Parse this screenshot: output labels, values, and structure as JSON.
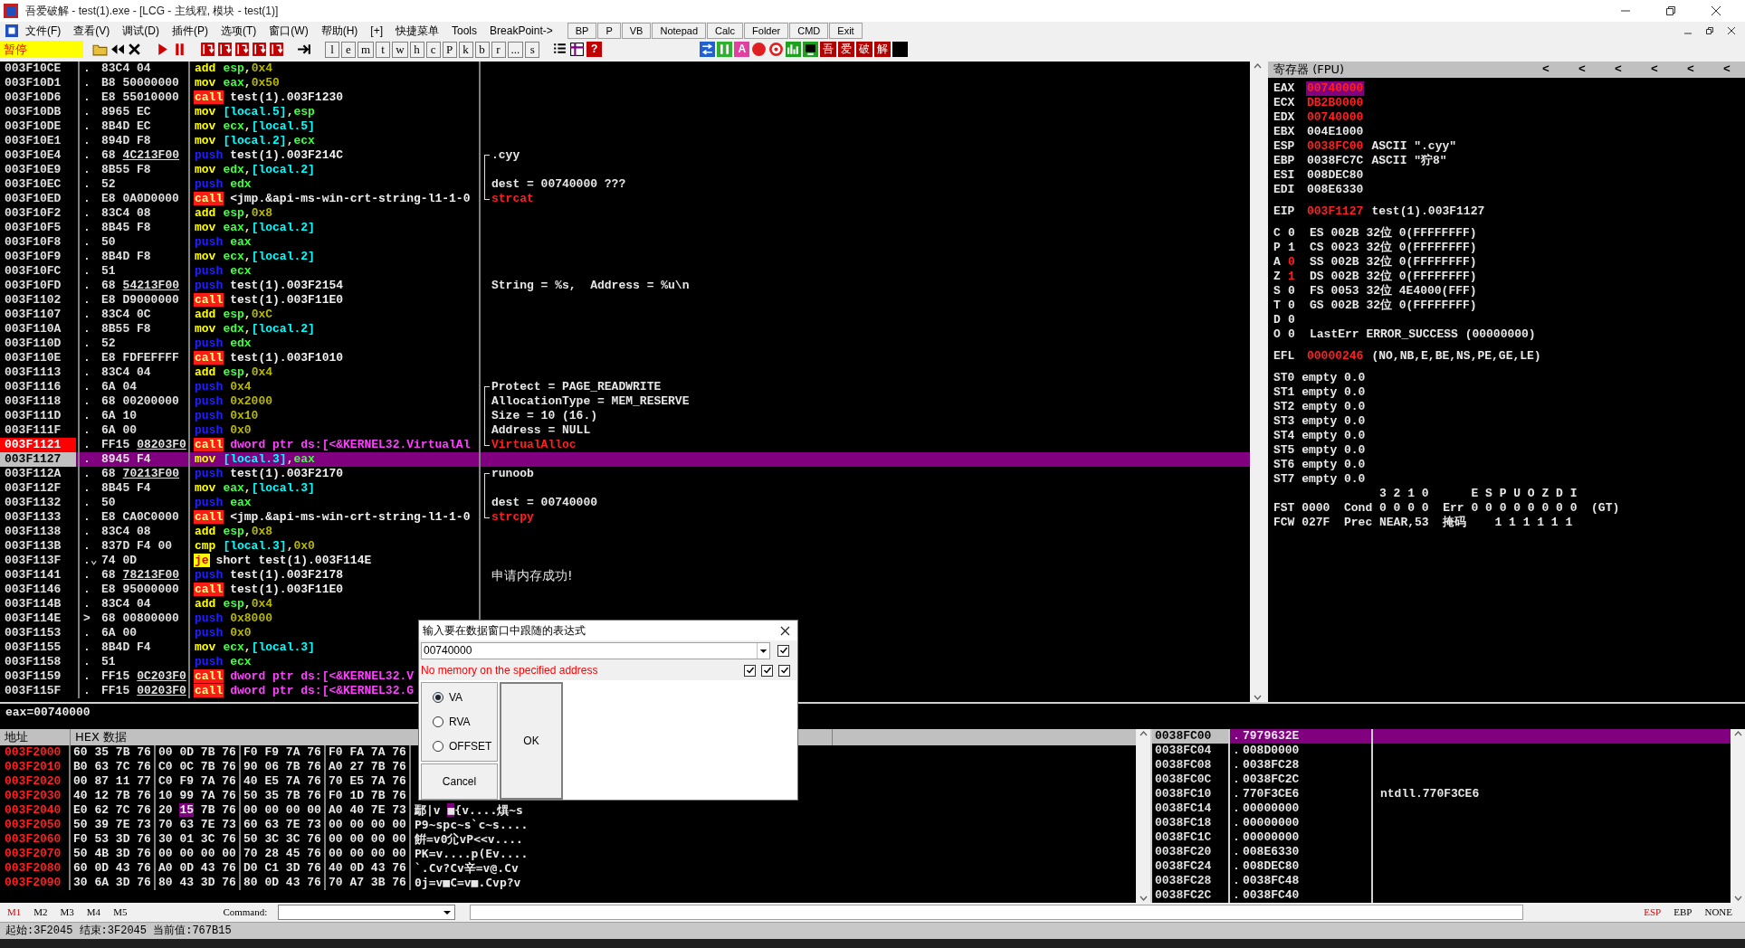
{
  "window": {
    "title": "吾爱破解 - test(1).exe - [LCG - 主线程, 模块 - test(1)]"
  },
  "menu": [
    "文件(F)",
    "查看(V)",
    "调试(D)",
    "插件(P)",
    "选项(T)",
    "窗口(W)",
    "帮助(H)",
    "[+]",
    "快捷菜单",
    "Tools",
    "BreakPoint->"
  ],
  "quick_buttons": [
    "BP",
    "P",
    "VB",
    "Notepad",
    "Calc",
    "Folder",
    "CMD",
    "Exit"
  ],
  "toolbar": {
    "status": "暂停",
    "items": [
      {
        "kind": "open"
      },
      {
        "kind": "rewind"
      },
      {
        "kind": "close"
      },
      {
        "kind": "gap"
      },
      {
        "kind": "run"
      },
      {
        "kind": "pause"
      },
      {
        "kind": "gap"
      },
      {
        "kind": "step"
      },
      {
        "kind": "step"
      },
      {
        "kind": "step"
      },
      {
        "kind": "step"
      },
      {
        "kind": "step"
      },
      {
        "kind": "gap"
      },
      {
        "kind": "goto"
      },
      {
        "kind": "gap"
      },
      {
        "kind": "letter",
        "label": "l"
      },
      {
        "kind": "letter",
        "label": "e"
      },
      {
        "kind": "letter",
        "label": "m"
      },
      {
        "kind": "letter",
        "label": "t"
      },
      {
        "kind": "letter",
        "label": "w"
      },
      {
        "kind": "letter",
        "label": "h"
      },
      {
        "kind": "letter",
        "label": "c"
      },
      {
        "kind": "letter",
        "label": "P"
      },
      {
        "kind": "letter",
        "label": "k"
      },
      {
        "kind": "letter",
        "label": "b"
      },
      {
        "kind": "letter",
        "label": "r"
      },
      {
        "kind": "letter",
        "label": "..."
      },
      {
        "kind": "letter",
        "label": "s"
      },
      {
        "kind": "gap"
      },
      {
        "kind": "list"
      },
      {
        "kind": "windows"
      },
      {
        "kind": "help",
        "label": "?"
      }
    ],
    "right_items": [
      {
        "kind": "swap"
      },
      {
        "kind": "bars"
      },
      {
        "kind": "pink_tile",
        "label": "A"
      },
      {
        "kind": "record"
      },
      {
        "kind": "target"
      },
      {
        "kind": "chart"
      },
      {
        "kind": "monitor"
      },
      {
        "kind": "red_tile",
        "label": "吾"
      },
      {
        "kind": "red_tile",
        "label": "爱"
      },
      {
        "kind": "red_tile",
        "label": "破"
      },
      {
        "kind": "red_tile",
        "label": "解"
      },
      {
        "kind": "black"
      }
    ]
  },
  "disassembly": {
    "rows": [
      {
        "address": "003F10CE",
        "marker": ".",
        "bytes": "83C4 04",
        "op": {
          "text": "add",
          "kind": "arith"
        },
        "args": [
          {
            "text": "esp",
            "kind": "reg"
          },
          {
            "text": ",",
            "kind": "sep"
          },
          {
            "text": "0x4",
            "kind": "imm"
          }
        ],
        "breakpoint": false,
        "selected": false
      },
      {
        "address": "003F10D1",
        "marker": ".",
        "bytes": "B8 50000000",
        "op": {
          "text": "mov",
          "kind": "arith"
        },
        "args": [
          {
            "text": "eax",
            "kind": "reg"
          },
          {
            "text": ",",
            "kind": "sep"
          },
          {
            "text": "0x50",
            "kind": "imm"
          }
        ],
        "breakpoint": false,
        "selected": false
      },
      {
        "address": "003F10D6",
        "marker": ".",
        "bytes": "E8 55010000",
        "op": {
          "text": "call",
          "kind": "call"
        },
        "args": [
          {
            "text": "test(1).003F1230",
            "kind": "sym"
          }
        ],
        "breakpoint": false,
        "selected": false
      },
      {
        "address": "003F10DB",
        "marker": ".",
        "bytes": "8965 EC",
        "op": {
          "text": "mov",
          "kind": "arith"
        },
        "args": [
          {
            "text": "[local.5]",
            "kind": "mem"
          },
          {
            "text": ",",
            "kind": "sep"
          },
          {
            "text": "esp",
            "kind": "reg"
          }
        ],
        "breakpoint": false,
        "selected": false
      },
      {
        "address": "003F10DE",
        "marker": ".",
        "bytes": "8B4D EC",
        "op": {
          "text": "mov",
          "kind": "arith"
        },
        "args": [
          {
            "text": "ecx",
            "kind": "reg"
          },
          {
            "text": ",",
            "kind": "sep"
          },
          {
            "text": "[local.5]",
            "kind": "mem"
          }
        ],
        "breakpoint": false,
        "selected": false
      },
      {
        "address": "003F10E1",
        "marker": ".",
        "bytes": "894D F8",
        "op": {
          "text": "mov",
          "kind": "arith"
        },
        "args": [
          {
            "text": "[local.2]",
            "kind": "mem"
          },
          {
            "text": ",",
            "kind": "sep"
          },
          {
            "text": "ecx",
            "kind": "reg"
          }
        ],
        "breakpoint": false,
        "selected": false
      },
      {
        "address": "003F10E4",
        "marker": ".",
        "bytes": "68",
        "reloc": "4C213F00",
        "op": {
          "text": "push",
          "kind": "stack"
        },
        "args": [
          {
            "text": "test(1).003F214C",
            "kind": "sym"
          }
        ],
        "comment": {
          "text": ".cyy",
          "kind": "text"
        },
        "bracket": {
          "kind": "start"
        },
        "breakpoint": false,
        "selected": false
      },
      {
        "address": "003F10E9",
        "marker": ".",
        "bytes": "8B55 F8",
        "op": {
          "text": "mov",
          "kind": "arith"
        },
        "args": [
          {
            "text": "edx",
            "kind": "reg"
          },
          {
            "text": ",",
            "kind": "sep"
          },
          {
            "text": "[local.2]",
            "kind": "mem"
          }
        ],
        "bracket": {
          "kind": "mid"
        },
        "breakpoint": false,
        "selected": false
      },
      {
        "address": "003F10EC",
        "marker": ".",
        "bytes": "52",
        "op": {
          "text": "push",
          "kind": "stack"
        },
        "args": [
          {
            "text": "edx",
            "kind": "reg"
          }
        ],
        "comment": {
          "text": "dest = 00740000 ???",
          "kind": "text"
        },
        "bracket": {
          "kind": "mid"
        },
        "breakpoint": false,
        "selected": false
      },
      {
        "address": "003F10ED",
        "marker": ".",
        "bytes": "E8 0A0D0000",
        "op": {
          "text": "call",
          "kind": "call"
        },
        "args": [
          {
            "text": "<jmp.&api-ms-win-crt-string-l1-1-0",
            "kind": "sym"
          }
        ],
        "comment": {
          "text": "strcat",
          "kind": "api"
        },
        "bracket": {
          "kind": "end"
        },
        "breakpoint": false,
        "selected": false
      },
      {
        "address": "003F10F2",
        "marker": ".",
        "bytes": "83C4 08",
        "op": {
          "text": "add",
          "kind": "arith"
        },
        "args": [
          {
            "text": "esp",
            "kind": "reg"
          },
          {
            "text": ",",
            "kind": "sep"
          },
          {
            "text": "0x8",
            "kind": "imm"
          }
        ],
        "breakpoint": false,
        "selected": false
      },
      {
        "address": "003F10F5",
        "marker": ".",
        "bytes": "8B45 F8",
        "op": {
          "text": "mov",
          "kind": "arith"
        },
        "args": [
          {
            "text": "eax",
            "kind": "reg"
          },
          {
            "text": ",",
            "kind": "sep"
          },
          {
            "text": "[local.2]",
            "kind": "mem"
          }
        ],
        "breakpoint": false,
        "selected": false
      },
      {
        "address": "003F10F8",
        "marker": ".",
        "bytes": "50",
        "op": {
          "text": "push",
          "kind": "stack"
        },
        "args": [
          {
            "text": "eax",
            "kind": "reg"
          }
        ],
        "breakpoint": false,
        "selected": false
      },
      {
        "address": "003F10F9",
        "marker": ".",
        "bytes": "8B4D F8",
        "op": {
          "text": "mov",
          "kind": "arith"
        },
        "args": [
          {
            "text": "ecx",
            "kind": "reg"
          },
          {
            "text": ",",
            "kind": "sep"
          },
          {
            "text": "[local.2]",
            "kind": "mem"
          }
        ],
        "breakpoint": false,
        "selected": false
      },
      {
        "address": "003F10FC",
        "marker": ".",
        "bytes": "51",
        "op": {
          "text": "push",
          "kind": "stack"
        },
        "args": [
          {
            "text": "ecx",
            "kind": "reg"
          }
        ],
        "breakpoint": false,
        "selected": false
      },
      {
        "address": "003F10FD",
        "marker": ".",
        "bytes": "68",
        "reloc": "54213F00",
        "op": {
          "text": "push",
          "kind": "stack"
        },
        "args": [
          {
            "text": "test(1).003F2154",
            "kind": "sym"
          }
        ],
        "comment": {
          "text": "String = %s,  Address = %u\\n",
          "kind": "text"
        },
        "breakpoint": false,
        "selected": false
      },
      {
        "address": "003F1102",
        "marker": ".",
        "bytes": "E8 D9000000",
        "op": {
          "text": "call",
          "kind": "call"
        },
        "args": [
          {
            "text": "test(1).003F11E0",
            "kind": "sym"
          }
        ],
        "breakpoint": false,
        "selected": false
      },
      {
        "address": "003F1107",
        "marker": ".",
        "bytes": "83C4 0C",
        "op": {
          "text": "add",
          "kind": "arith"
        },
        "args": [
          {
            "text": "esp",
            "kind": "reg"
          },
          {
            "text": ",",
            "kind": "sep"
          },
          {
            "text": "0xC",
            "kind": "imm"
          }
        ],
        "breakpoint": false,
        "selected": false
      },
      {
        "address": "003F110A",
        "marker": ".",
        "bytes": "8B55 F8",
        "op": {
          "text": "mov",
          "kind": "arith"
        },
        "args": [
          {
            "text": "edx",
            "kind": "reg"
          },
          {
            "text": ",",
            "kind": "sep"
          },
          {
            "text": "[local.2]",
            "kind": "mem"
          }
        ],
        "breakpoint": false,
        "selected": false
      },
      {
        "address": "003F110D",
        "marker": ".",
        "bytes": "52",
        "op": {
          "text": "push",
          "kind": "stack"
        },
        "args": [
          {
            "text": "edx",
            "kind": "reg"
          }
        ],
        "breakpoint": false,
        "selected": false
      },
      {
        "address": "003F110E",
        "marker": ".",
        "bytes": "E8 FDFEFFFF",
        "op": {
          "text": "call",
          "kind": "call"
        },
        "args": [
          {
            "text": "test(1).003F1010",
            "kind": "sym"
          }
        ],
        "breakpoint": false,
        "selected": false
      },
      {
        "address": "003F1113",
        "marker": ".",
        "bytes": "83C4 04",
        "op": {
          "text": "add",
          "kind": "arith"
        },
        "args": [
          {
            "text": "esp",
            "kind": "reg"
          },
          {
            "text": ",",
            "kind": "sep"
          },
          {
            "text": "0x4",
            "kind": "imm"
          }
        ],
        "breakpoint": false,
        "selected": false
      },
      {
        "address": "003F1116",
        "marker": ".",
        "bytes": "6A 04",
        "op": {
          "text": "push",
          "kind": "stack"
        },
        "args": [
          {
            "text": "0x4",
            "kind": "imm"
          }
        ],
        "comment": {
          "text": "Protect = PAGE_READWRITE",
          "kind": "text"
        },
        "bracket": {
          "kind": "start"
        },
        "breakpoint": false,
        "selected": false
      },
      {
        "address": "003F1118",
        "marker": ".",
        "bytes": "68 00200000",
        "op": {
          "text": "push",
          "kind": "stack"
        },
        "args": [
          {
            "text": "0x2000",
            "kind": "imm"
          }
        ],
        "comment": {
          "text": "AllocationType = MEM_RESERVE",
          "kind": "text"
        },
        "bracket": {
          "kind": "mid"
        },
        "breakpoint": false,
        "selected": false
      },
      {
        "address": "003F111D",
        "marker": ".",
        "bytes": "6A 10",
        "op": {
          "text": "push",
          "kind": "stack"
        },
        "args": [
          {
            "text": "0x10",
            "kind": "imm"
          }
        ],
        "comment": {
          "text": "Size = 10 (16.)",
          "kind": "text"
        },
        "bracket": {
          "kind": "mid"
        },
        "breakpoint": false,
        "selected": false
      },
      {
        "address": "003F111F",
        "marker": ".",
        "bytes": "6A 00",
        "op": {
          "text": "push",
          "kind": "stack"
        },
        "args": [
          {
            "text": "0x0",
            "kind": "imm"
          }
        ],
        "comment": {
          "text": "Address = NULL",
          "kind": "text"
        },
        "bracket": {
          "kind": "mid"
        },
        "breakpoint": false,
        "selected": false
      },
      {
        "address": "003F1121",
        "marker": ".",
        "bytes": "FF15",
        "reloc": "08203F0",
        "op": {
          "text": "call",
          "kind": "call"
        },
        "args": [
          {
            "text": "dword ptr ds:[<&KERNEL32.VirtualAl",
            "kind": "api"
          }
        ],
        "comment": {
          "text": "VirtualAlloc",
          "kind": "api"
        },
        "bracket": {
          "kind": "end"
        },
        "breakpoint": true,
        "selected": false
      },
      {
        "address": "003F1127",
        "marker": ".",
        "bytes": "8945 F4",
        "op": {
          "text": "mov",
          "kind": "arith"
        },
        "args": [
          {
            "text": "[local.3]",
            "kind": "mem"
          },
          {
            "text": ",",
            "kind": "sep"
          },
          {
            "text": "eax",
            "kind": "reg"
          }
        ],
        "breakpoint": false,
        "selected": true
      },
      {
        "address": "003F112A",
        "marker": ".",
        "bytes": "68",
        "reloc": "70213F00",
        "op": {
          "text": "push",
          "kind": "stack"
        },
        "args": [
          {
            "text": "test(1).003F2170",
            "kind": "sym"
          }
        ],
        "comment": {
          "text": "runoob",
          "kind": "text"
        },
        "bracket": {
          "kind": "start"
        },
        "breakpoint": false,
        "selected": false
      },
      {
        "address": "003F112F",
        "marker": ".",
        "bytes": "8B45 F4",
        "op": {
          "text": "mov",
          "kind": "arith"
        },
        "args": [
          {
            "text": "eax",
            "kind": "reg"
          },
          {
            "text": ",",
            "kind": "sep"
          },
          {
            "text": "[local.3]",
            "kind": "mem"
          }
        ],
        "bracket": {
          "kind": "mid"
        },
        "breakpoint": false,
        "selected": false
      },
      {
        "address": "003F1132",
        "marker": ".",
        "bytes": "50",
        "op": {
          "text": "push",
          "kind": "stack"
        },
        "args": [
          {
            "text": "eax",
            "kind": "reg"
          }
        ],
        "comment": {
          "text": "dest = 00740000",
          "kind": "text"
        },
        "bracket": {
          "kind": "mid"
        },
        "breakpoint": false,
        "selected": false
      },
      {
        "address": "003F1133",
        "marker": ".",
        "bytes": "E8 CA0C0000",
        "op": {
          "text": "call",
          "kind": "call"
        },
        "args": [
          {
            "text": "<jmp.&api-ms-win-crt-string-l1-1-0",
            "kind": "sym"
          }
        ],
        "comment": {
          "text": "strcpy",
          "kind": "api"
        },
        "bracket": {
          "kind": "end"
        },
        "breakpoint": false,
        "selected": false
      },
      {
        "address": "003F1138",
        "marker": ".",
        "bytes": "83C4 08",
        "op": {
          "text": "add",
          "kind": "arith"
        },
        "args": [
          {
            "text": "esp",
            "kind": "reg"
          },
          {
            "text": ",",
            "kind": "sep"
          },
          {
            "text": "0x8",
            "kind": "imm"
          }
        ],
        "breakpoint": false,
        "selected": false
      },
      {
        "address": "003F113B",
        "marker": ".",
        "bytes": "837D F4 00",
        "op": {
          "text": "cmp",
          "kind": "arith"
        },
        "args": [
          {
            "text": "[local.3]",
            "kind": "mem"
          },
          {
            "text": ",",
            "kind": "sep"
          },
          {
            "text": "0x0",
            "kind": "imm"
          }
        ],
        "breakpoint": false,
        "selected": false
      },
      {
        "address": "003F113F",
        "marker": ".⌄",
        "bytes": "74 0D",
        "op": {
          "text": "je",
          "kind": "jump"
        },
        "args": [
          {
            "text": "short test(1).003F114E",
            "kind": "sym"
          }
        ],
        "breakpoint": false,
        "selected": false
      },
      {
        "address": "003F1141",
        "marker": ".",
        "bytes": "68",
        "reloc": "78213F00",
        "op": {
          "text": "push",
          "kind": "stack"
        },
        "args": [
          {
            "text": "test(1).003F2178",
            "kind": "sym"
          }
        ],
        "comment": {
          "text": "申请内存成功!",
          "kind": "cjk"
        },
        "breakpoint": false,
        "selected": false
      },
      {
        "address": "003F1146",
        "marker": ".",
        "bytes": "E8 95000000",
        "op": {
          "text": "call",
          "kind": "call"
        },
        "args": [
          {
            "text": "test(1).003F11E0",
            "kind": "sym"
          }
        ],
        "breakpoint": false,
        "selected": false
      },
      {
        "address": "003F114B",
        "marker": ".",
        "bytes": "83C4 04",
        "op": {
          "text": "add",
          "kind": "arith"
        },
        "args": [
          {
            "text": "esp",
            "kind": "reg"
          },
          {
            "text": ",",
            "kind": "sep"
          },
          {
            "text": "0x4",
            "kind": "imm"
          }
        ],
        "breakpoint": false,
        "selected": false
      },
      {
        "address": "003F114E",
        "marker": ">",
        "bytes": "68 00800000",
        "op": {
          "text": "push",
          "kind": "stack"
        },
        "args": [
          {
            "text": "0x8000",
            "kind": "imm"
          }
        ],
        "breakpoint": false,
        "selected": false
      },
      {
        "address": "003F1153",
        "marker": ".",
        "bytes": "6A 00",
        "op": {
          "text": "push",
          "kind": "stack"
        },
        "args": [
          {
            "text": "0x0",
            "kind": "imm"
          }
        ],
        "breakpoint": false,
        "selected": false
      },
      {
        "address": "003F1155",
        "marker": ".",
        "bytes": "8B4D F4",
        "op": {
          "text": "mov",
          "kind": "arith"
        },
        "args": [
          {
            "text": "ecx",
            "kind": "reg"
          },
          {
            "text": ",",
            "kind": "sep"
          },
          {
            "text": "[local.3]",
            "kind": "mem"
          }
        ],
        "breakpoint": false,
        "selected": false
      },
      {
        "address": "003F1158",
        "marker": ".",
        "bytes": "51",
        "op": {
          "text": "push",
          "kind": "stack"
        },
        "args": [
          {
            "text": "ecx",
            "kind": "reg"
          }
        ],
        "breakpoint": false,
        "selected": false
      },
      {
        "address": "003F1159",
        "marker": ".",
        "bytes": "FF15",
        "reloc": "0C203F0",
        "op": {
          "text": "call",
          "kind": "call"
        },
        "args": [
          {
            "text": "dword ptr ds:[<&KERNEL32.V",
            "kind": "api"
          }
        ],
        "breakpoint": false,
        "selected": false
      },
      {
        "address": "003F115F",
        "marker": ".",
        "bytes": "FF15",
        "reloc": "00203F0",
        "op": {
          "text": "call",
          "kind": "call"
        },
        "args": [
          {
            "text": "dword ptr ds:[<&KERNEL32.G",
            "kind": "api"
          }
        ],
        "breakpoint": false,
        "selected": false
      }
    ]
  },
  "registers": {
    "title": "寄存器 (FPU)",
    "arrows": [
      "<",
      "<",
      "<",
      "<",
      "<",
      "<"
    ],
    "general": [
      {
        "name": "EAX",
        "value": "00740000",
        "changed": true,
        "selected": true
      },
      {
        "name": "ECX",
        "value": "DB2B0000",
        "changed": true,
        "selected": false
      },
      {
        "name": "EDX",
        "value": "00740000",
        "changed": true,
        "selected": false
      },
      {
        "name": "EBX",
        "value": "004E1000",
        "changed": false,
        "selected": false
      },
      {
        "name": "ESP",
        "value": "0038FC00",
        "changed": true,
        "selected": false,
        "note": "ASCII \".cyy\""
      },
      {
        "name": "EBP",
        "value": "0038FC7C",
        "changed": false,
        "selected": false,
        "note": "ASCII \"狞8\""
      },
      {
        "name": "ESI",
        "value": "008DEC80",
        "changed": false,
        "selected": false
      },
      {
        "name": "EDI",
        "value": "008E6330",
        "changed": false,
        "selected": false
      }
    ],
    "eip": {
      "name": "EIP",
      "value": "003F1127",
      "changed": true,
      "note": "test(1).003F1127"
    },
    "flags": [
      {
        "name": "C",
        "value": "0",
        "changed": false,
        "info": "ES 002B 32位 0(FFFFFFFF)"
      },
      {
        "name": "P",
        "value": "1",
        "changed": false,
        "info": "CS 0023 32位 0(FFFFFFFF)"
      },
      {
        "name": "A",
        "value": "0",
        "changed": true,
        "info": "SS 002B 32位 0(FFFFFFFF)"
      },
      {
        "name": "Z",
        "value": "1",
        "changed": true,
        "info": "DS 002B 32位 0(FFFFFFFF)"
      },
      {
        "name": "S",
        "value": "0",
        "changed": false,
        "info": "FS 0053 32位 4E4000(FFF)"
      },
      {
        "name": "T",
        "value": "0",
        "changed": false,
        "info": "GS 002B 32位 0(FFFFFFFF)"
      },
      {
        "name": "D",
        "value": "0",
        "changed": false
      },
      {
        "name": "O",
        "value": "0",
        "changed": false,
        "info": "LastErr ERROR_SUCCESS (00000000)"
      }
    ],
    "efl": {
      "name": "EFL",
      "value": "00000246",
      "changed": true,
      "note": "(NO,NB,E,BE,NS,PE,GE,LE)"
    },
    "fpu": [
      "ST0 empty 0.0",
      "ST1 empty 0.0",
      "ST2 empty 0.0",
      "ST3 empty 0.0",
      "ST4 empty 0.0",
      "ST5 empty 0.0",
      "ST6 empty 0.0",
      "ST7 empty 0.0"
    ],
    "status_lines": [
      "               3 2 1 0      E S P U O Z D I",
      "FST 0000  Cond 0 0 0 0  Err 0 0 0 0 0 0 0 0  (GT)",
      "FCW 027F  Prec NEAR,53  掩码    1 1 1 1 1 1"
    ]
  },
  "info": {
    "text": "eax=00740000"
  },
  "dump": {
    "columns": [
      "地址",
      "HEX 数据"
    ],
    "rows": [
      {
        "kind": "plain",
        "address": "003F2000",
        "hex": "60 35 7B 76 00 0D 7B 76 F0 F9 7A 76 F0 FA 7A 76"
      },
      {
        "kind": "plain",
        "address": "003F2010",
        "hex": "B0 63 7C 76 C0 0C 7B 76 90 06 7B 76 A0 27 7B 76"
      },
      {
        "kind": "plain",
        "address": "003F2020",
        "hex": "00 87 11 77 C0 F9 7A 76 40 E5 7A 76 70 E5 7A 76"
      },
      {
        "kind": "plain",
        "address": "003F2030",
        "hex": "40 12 7B 76 10 99 7A 76 50 35 7B 76 F0 1D 7B 76"
      },
      {
        "kind": "selection",
        "address": "003F2040",
        "hex_before": "E0 62 7C 76 20",
        "hex_selected": "15",
        "hex_after": "7B 76 00 00 00 00 A0 40 7E 73",
        "ascii_before": "鄢|v ",
        "ascii_selected": "■",
        "ascii_after": "{v....熼~s"
      },
      {
        "kind": "plain",
        "address": "003F2050",
        "hex": "50 39 7E 73 70 63 7E 73 60 63 7E 73 00 00 00 00",
        "ascii": "P9~spc~s`c~s...."
      },
      {
        "kind": "plain",
        "address": "003F2060",
        "hex": "F0 53 3D 76 30 01 3C 76 50 3C 3C 76 00 00 00 00",
        "ascii": "餠=v0尣vP<<v...."
      },
      {
        "kind": "plain",
        "address": "003F2070",
        "hex": "50 4B 3D 76 00 00 00 00 70 28 45 76 00 00 00 00",
        "ascii": "PK=v....p(Ev...."
      },
      {
        "kind": "plain",
        "address": "003F2080",
        "hex": "60 0D 43 76 A0 0D 43 76 D0 C1 3D 76 40 0D 43 76",
        "ascii": "`.Cv?Cv辛=v@.Cv"
      },
      {
        "kind": "plain",
        "address": "003F2090",
        "hex": "30 6A 3D 76 80 43 3D 76 80 0D 43 76 70 A7 3B 76",
        "ascii": "0j=v■C=v■.Cvp?v"
      }
    ]
  },
  "stack": {
    "rows": [
      {
        "address": "0038FC00",
        "marker": ".",
        "value": "7979632E",
        "selected": true
      },
      {
        "address": "0038FC04",
        "marker": ".",
        "value": "008D0000",
        "selected": false
      },
      {
        "address": "0038FC08",
        "marker": ".",
        "value": "0038FC28",
        "selected": false
      },
      {
        "address": "0038FC0C",
        "marker": ".",
        "value": "0038FC2C",
        "selected": false
      },
      {
        "address": "0038FC10",
        "marker": ".",
        "value": "770F3CE6",
        "comment": "ntdll.770F3CE6",
        "selected": false
      },
      {
        "address": "0038FC14",
        "marker": ".",
        "value": "00000000",
        "selected": false
      },
      {
        "address": "0038FC18",
        "marker": ".",
        "value": "00000000",
        "selected": false
      },
      {
        "address": "0038FC1C",
        "marker": ".",
        "value": "00000000",
        "selected": false
      },
      {
        "address": "0038FC20",
        "marker": ".",
        "value": "008E6330",
        "selected": false
      },
      {
        "address": "0038FC24",
        "marker": ".",
        "value": "008DEC80",
        "selected": false
      },
      {
        "address": "0038FC28",
        "marker": ".",
        "value": "0038FC48",
        "selected": false
      },
      {
        "address": "0038FC2C",
        "marker": ".",
        "value": "0038FC40",
        "selected": false
      }
    ]
  },
  "dialog": {
    "title": "输入要在数据窗口中跟随的表达式",
    "value": "00740000",
    "error": "No memory on the specified address",
    "combo_checks": [
      {
        "checked": true
      }
    ],
    "error_checks": [
      {
        "checked": true
      },
      {
        "checked": true
      },
      {
        "checked": true
      }
    ],
    "options": [
      {
        "label": "VA",
        "selected": true
      },
      {
        "label": "RVA",
        "selected": false
      },
      {
        "label": "OFFSET",
        "selected": false
      }
    ],
    "ok": "OK",
    "cancel": "Cancel"
  },
  "command_bar": {
    "marks": [
      {
        "label": "M1",
        "selected": true
      },
      {
        "label": "M2",
        "selected": false
      },
      {
        "label": "M3",
        "selected": false
      },
      {
        "label": "M4",
        "selected": false
      },
      {
        "label": "M5",
        "selected": false
      }
    ],
    "label": "Command:",
    "bases": [
      {
        "label": "ESP",
        "selected": true
      },
      {
        "label": "EBP",
        "selected": false
      },
      {
        "label": "NONE",
        "selected": false
      }
    ]
  },
  "status_bar": {
    "text": "起始:3F2045 结束:3F2045 当前值:767B15"
  }
}
